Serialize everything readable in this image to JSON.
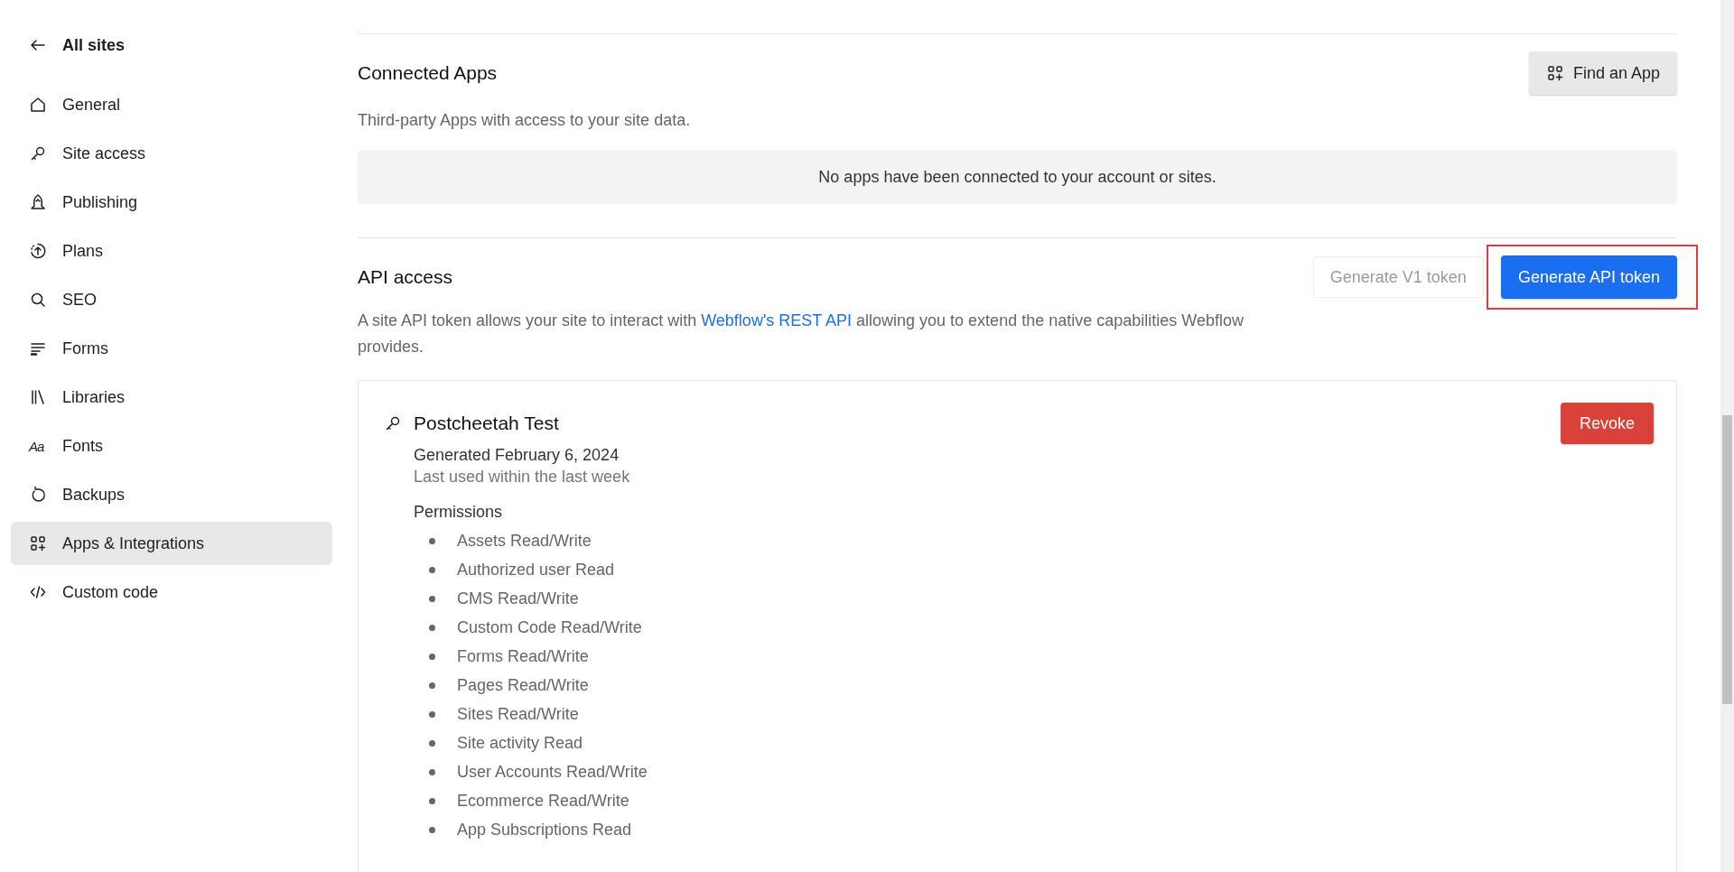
{
  "sidebar": {
    "back_link": "All sites",
    "items": [
      {
        "label": "General",
        "selected": false
      },
      {
        "label": "Site access",
        "selected": false
      },
      {
        "label": "Publishing",
        "selected": false
      },
      {
        "label": "Plans",
        "selected": false
      },
      {
        "label": "SEO",
        "selected": false
      },
      {
        "label": "Forms",
        "selected": false
      },
      {
        "label": "Libraries",
        "selected": false
      },
      {
        "label": "Fonts",
        "selected": false,
        "icon_text": "Aa"
      },
      {
        "label": "Backups",
        "selected": false
      },
      {
        "label": "Apps & Integrations",
        "selected": true
      },
      {
        "label": "Custom code",
        "selected": false
      }
    ]
  },
  "connected_apps": {
    "title": "Connected Apps",
    "button": "Find an App",
    "subtitle": "Third-party Apps with access to your site data.",
    "empty_message": "No apps have been connected to your account or sites."
  },
  "api_access": {
    "title": "API access",
    "buttons": [
      {
        "label": "Generate V1 token",
        "kind": "secondary",
        "disabled": true,
        "highlighted": false
      },
      {
        "label": "Generate API token",
        "kind": "primary",
        "disabled": false,
        "highlighted": true
      }
    ],
    "description": {
      "before": "A site API token allows your site to interact with ",
      "link": "Webflow's REST API",
      "after": " allowing you to extend the native capabilities Webflow provides."
    },
    "token": {
      "name": "Postcheetah Test",
      "button": "Revoke",
      "generated": "Generated February 6, 2024",
      "last_used": "Last used within the last week",
      "permissions_title": "Permissions",
      "permissions": [
        "Assets Read/Write",
        "Authorized user Read",
        "CMS Read/Write",
        "Custom Code Read/Write",
        "Forms Read/Write",
        "Pages Read/Write",
        "Sites Read/Write",
        "Site activity Read",
        "User Accounts Read/Write",
        "Ecommerce Read/Write",
        "App Subscriptions Read"
      ]
    }
  }
}
